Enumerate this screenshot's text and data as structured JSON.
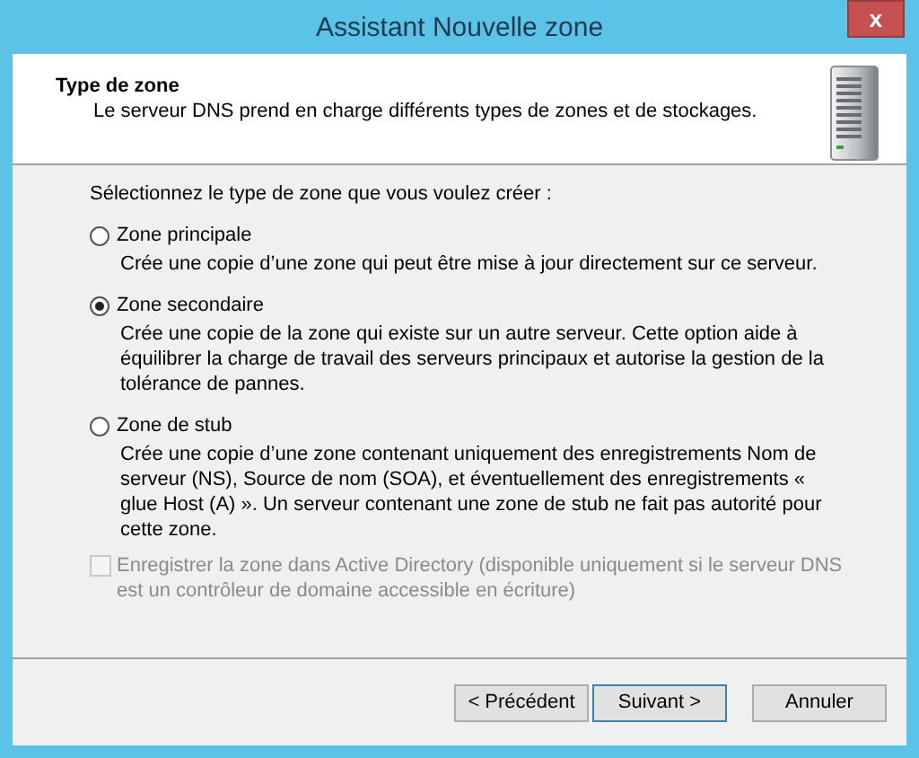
{
  "window": {
    "title": "Assistant Nouvelle zone",
    "close": "x"
  },
  "header": {
    "title": "Type de zone",
    "subtitle": "Le serveur DNS prend en charge différents types de zones et de stockages."
  },
  "prompt": "Sélectionnez le type de zone que vous voulez créer :",
  "options": [
    {
      "label": "Zone principale",
      "description": "Crée une copie d’une zone qui peut être mise à jour directement sur ce serveur.",
      "selected": false
    },
    {
      "label": "Zone secondaire",
      "description": "Crée une copie de la zone qui existe sur un autre serveur. Cette option aide à équilibrer la charge de travail des serveurs principaux et autorise la gestion de la tolérance de pannes.",
      "selected": true
    },
    {
      "label": "Zone de stub",
      "description": "Crée une copie d’une zone contenant uniquement des enregistrements Nom de serveur (NS), Source de nom (SOA), et éventuellement des enregistrements « glue Host (A) ». Un serveur contenant une zone de stub ne fait pas autorité pour cette zone.",
      "selected": false
    }
  ],
  "ad_checkbox": {
    "label": "Enregistrer la zone dans Active Directory (disponible uniquement si le serveur DNS est un contrôleur de domaine accessible en écriture)",
    "checked": false,
    "disabled": true
  },
  "buttons": [
    {
      "label": "< Précédent",
      "kind": "back"
    },
    {
      "label": "Suivant >",
      "kind": "next"
    },
    {
      "label": "Annuler",
      "kind": "cancel"
    }
  ]
}
